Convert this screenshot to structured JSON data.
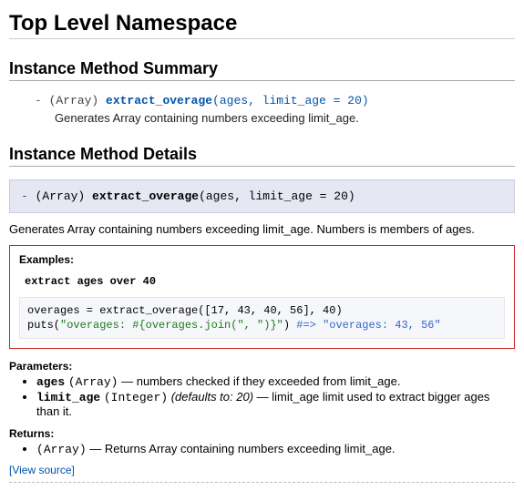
{
  "page_title": "Top Level Namespace",
  "sections": {
    "summary_title": "Instance Method Summary",
    "details_title": "Instance Method Details"
  },
  "summary": {
    "dash": "- ",
    "type": "(Array) ",
    "name": "extract_overage",
    "args": "(ages, limit_age = 20)",
    "desc": "Generates Array containing numbers exceeding limit_age."
  },
  "detail": {
    "sig_dash": "- ",
    "sig_type": "(Array) ",
    "sig_name": "extract_overage",
    "sig_args": "(ages, limit_age = 20)",
    "desc": "Generates Array containing numbers exceeding limit_age. Numbers is members of ages."
  },
  "examples": {
    "label": "Examples:",
    "caption": "extract ages over 40",
    "code_line1": "overages = extract_overage([17, 43, 40, 56], 40)",
    "code_line2a": "puts(",
    "code_line2_str": "\"overages: #{overages.join(\", \")}\"",
    "code_line2b": ") ",
    "code_line2_cmt": "#=> \"overages: 43, 56\""
  },
  "params": {
    "label": "Parameters:",
    "items": [
      {
        "name": "ages",
        "type": "Array",
        "default": "",
        "desc": " — numbers checked if they exceeded from limit_age."
      },
      {
        "name": "limit_age",
        "type": "Integer",
        "default": "(defaults to: 20)",
        "desc": " — limit_age limit used to extract bigger ages than it."
      }
    ]
  },
  "returns": {
    "label": "Returns:",
    "type": "Array",
    "desc": " — Returns Array containing numbers exceeding limit_age."
  },
  "view_source": "View source"
}
